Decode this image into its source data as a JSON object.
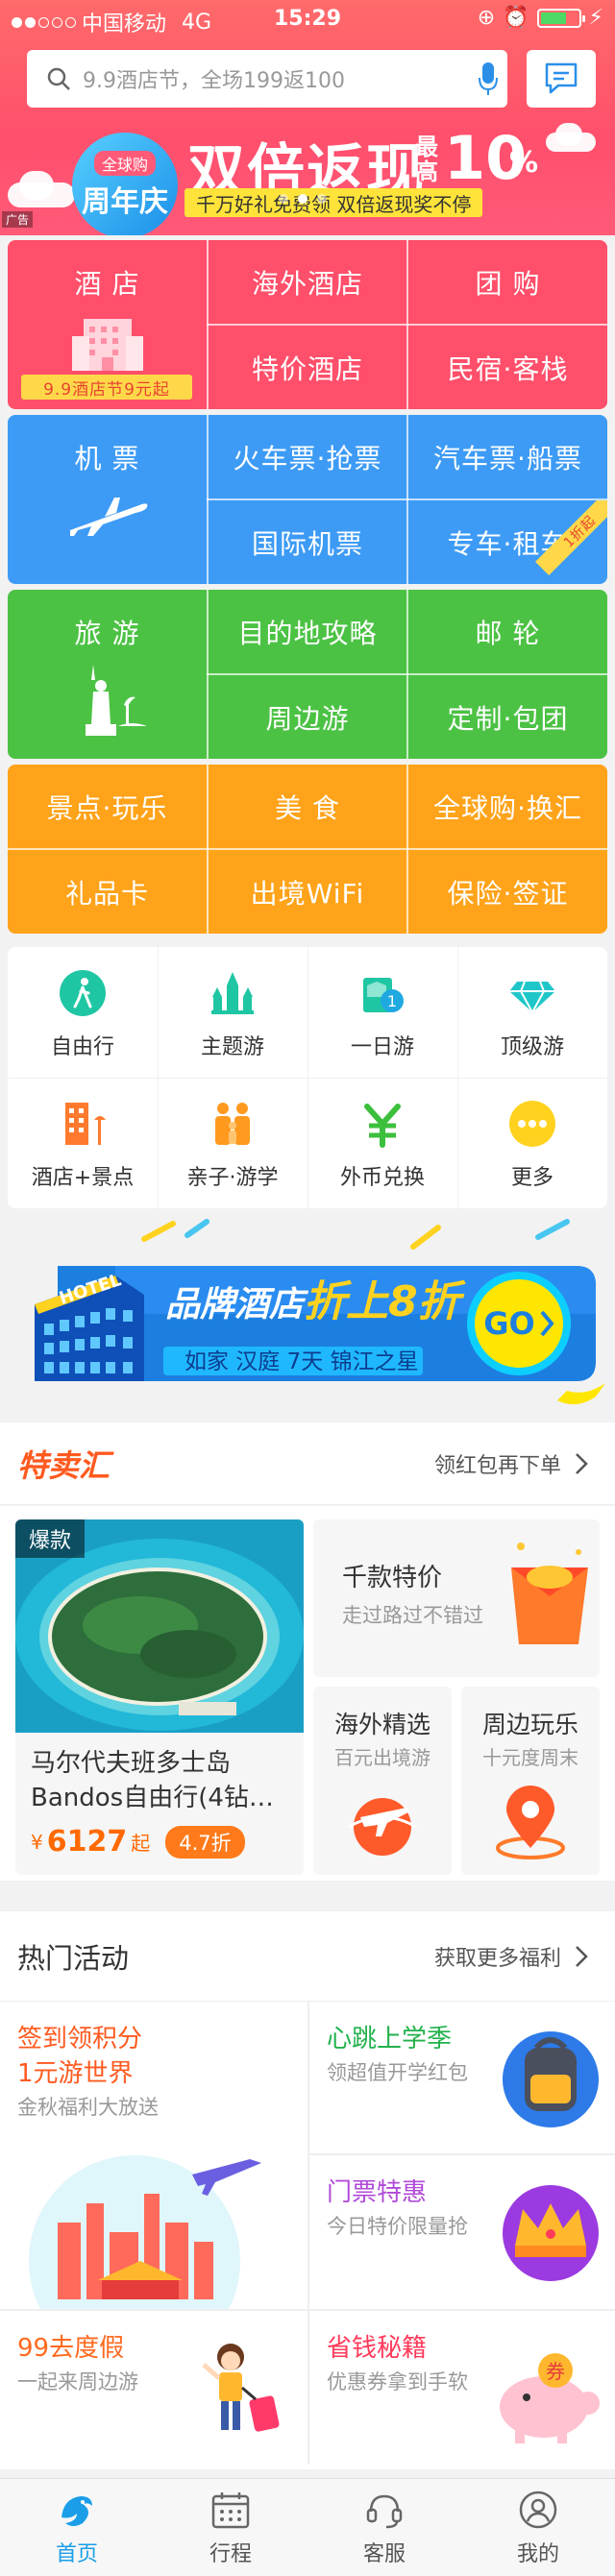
{
  "status_bar": {
    "carrier": "中国移动",
    "network": "4G",
    "time": "15:29",
    "battery_level": 0.7
  },
  "search": {
    "placeholder": "9.9酒店节，全场199返100"
  },
  "banner": {
    "badge_top": "全球购",
    "badge_main": "周年庆",
    "title": "双倍返现",
    "small": "最高",
    "big": "10",
    "pct": "%",
    "strip": "千万好礼免费领  双倍返现奖不停",
    "ad_tag": "广告",
    "page_count": 3,
    "active_page": 1
  },
  "colors": {
    "hotel": "#ff4f6a",
    "flight": "#3d9bf5",
    "travel": "#4cc244",
    "fun": "#ffa31a",
    "tab_active": "#1a9ee8",
    "accent": "#ff6a2a"
  },
  "grid_hotel": {
    "main": "酒 店",
    "sub": "9.9酒店节9元起",
    "items": [
      "海外酒店",
      "团 购",
      "特价酒店",
      "民宿·客栈"
    ]
  },
  "grid_flight": {
    "main": "机 票",
    "items": [
      "火车票·抢票",
      "汽车票·船票",
      "国际机票",
      "专车·租车"
    ],
    "badge": "1折起"
  },
  "grid_travel": {
    "main": "旅 游",
    "items": [
      "目的地攻略",
      "邮 轮",
      "周边游",
      "定制·包团"
    ]
  },
  "grid_fun": {
    "items": [
      "景点·玩乐",
      "美 食",
      "全球购·换汇",
      "礼品卡",
      "出境WiFi",
      "保险·签证"
    ]
  },
  "icon_grid": [
    {
      "label": "自由行",
      "icon": "walker-icon"
    },
    {
      "label": "主题游",
      "icon": "castle-icon"
    },
    {
      "label": "一日游",
      "icon": "day-trip-icon"
    },
    {
      "label": "顶级游",
      "icon": "diamond-icon"
    },
    {
      "label": "酒店+景点",
      "icon": "hotel-building-icon"
    },
    {
      "label": "亲子·游学",
      "icon": "family-icon"
    },
    {
      "label": "外币兑换",
      "icon": "yen-icon"
    },
    {
      "label": "更多",
      "icon": "more-icon"
    }
  ],
  "hotel_banner": {
    "sign": "HOTEL",
    "title": "品牌酒店折上8折",
    "title_a": "品牌酒店",
    "title_b": "折上",
    "title_c": "8折",
    "brands": "如家 汉庭 7天 锦江之星",
    "go": "GO"
  },
  "deals": {
    "title": "特卖汇",
    "more": "领红包再下单",
    "main": {
      "tag": "爆款",
      "name": "马尔代夫班多士岛Bandos自由行(4钻…",
      "price": "6127",
      "currency": "¥",
      "suffix": "起",
      "discount": "4.7折"
    },
    "side_top": {
      "title": "千款特价",
      "sub": "走过路过不错过"
    },
    "side_left": {
      "title": "海外精选",
      "sub": "百元出境游"
    },
    "side_right": {
      "title": "周边玩乐",
      "sub": "十元度周末"
    }
  },
  "hot": {
    "title": "热门活动",
    "more": "获取更多福利",
    "a": {
      "t1": "签到领积分",
      "t2": "1元游世界",
      "s": "金秋福利大放送"
    },
    "b": {
      "t": "心跳上学季",
      "s": "领超值开学红包"
    },
    "c": {
      "t": "门票特惠",
      "s": "今日特价限量抢"
    },
    "d": {
      "t": "99去度假",
      "s": "一起来周边游"
    },
    "e": {
      "t": "省钱秘籍",
      "s": "优惠券拿到手软",
      "stamp": "券"
    }
  },
  "tabbar": [
    "首页",
    "行程",
    "客服",
    "我的"
  ]
}
